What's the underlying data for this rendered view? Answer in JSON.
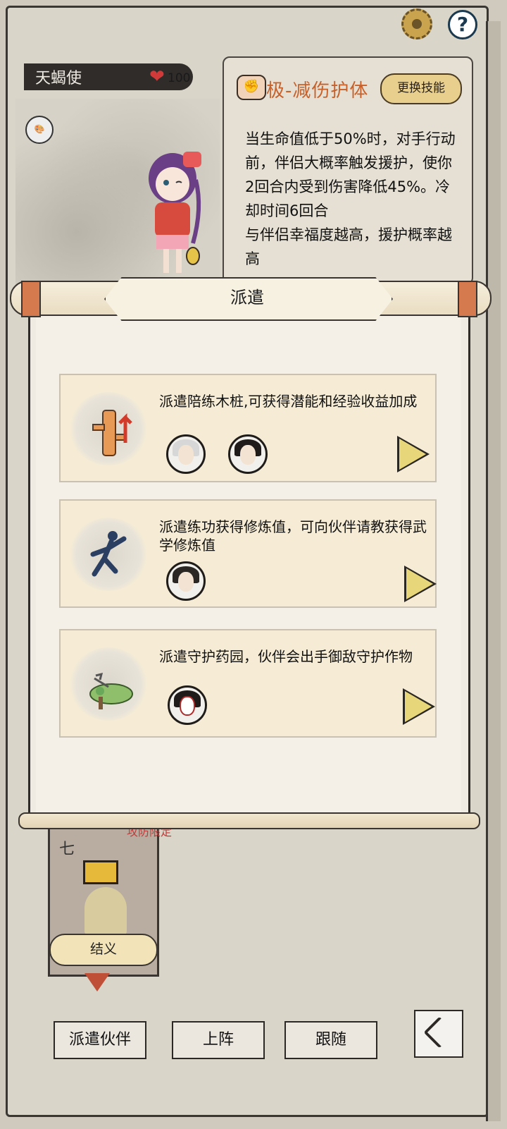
{
  "character": {
    "name": "天蝎使",
    "hp": "100"
  },
  "skill": {
    "name": "极-减伤护体",
    "change_label": "更换技能",
    "description": "当生命值低于50%时，对手行动前，伴侣大概率触发援护，使你2回合内受到伤害降低45%。冷却时间6回合\n与伴侣幸福度越高，援护概率越高"
  },
  "dialog": {
    "title": "派遣",
    "tasks": [
      {
        "description": "派遣陪练木桩,可获得潜能和经验收益加成",
        "icon": "training-dummy-icon",
        "avatars": [
          "white-haired-companion-avatar",
          "dark-haired-companion-avatar"
        ]
      },
      {
        "description": "派遣练功获得修炼值，可向伙伴请教获得武学修炼值",
        "icon": "martial-artist-icon",
        "avatars": [
          "hat-man-companion-avatar"
        ]
      },
      {
        "description": "派遣守护药园，伙伴会出手御敌守护作物",
        "icon": "herb-garden-icon",
        "avatars": [
          "masked-companion-avatar"
        ]
      }
    ]
  },
  "partner": {
    "number": "七",
    "red_note": "攻防限定",
    "sworn_label": "结义"
  },
  "bottom_bar": {
    "dispatch": "派遣伙伴",
    "deploy": "上阵",
    "follow": "跟随"
  },
  "colors": {
    "skill_name": "#c8602a",
    "play_button": "#e8d77a",
    "heart": "#d23a3a"
  }
}
